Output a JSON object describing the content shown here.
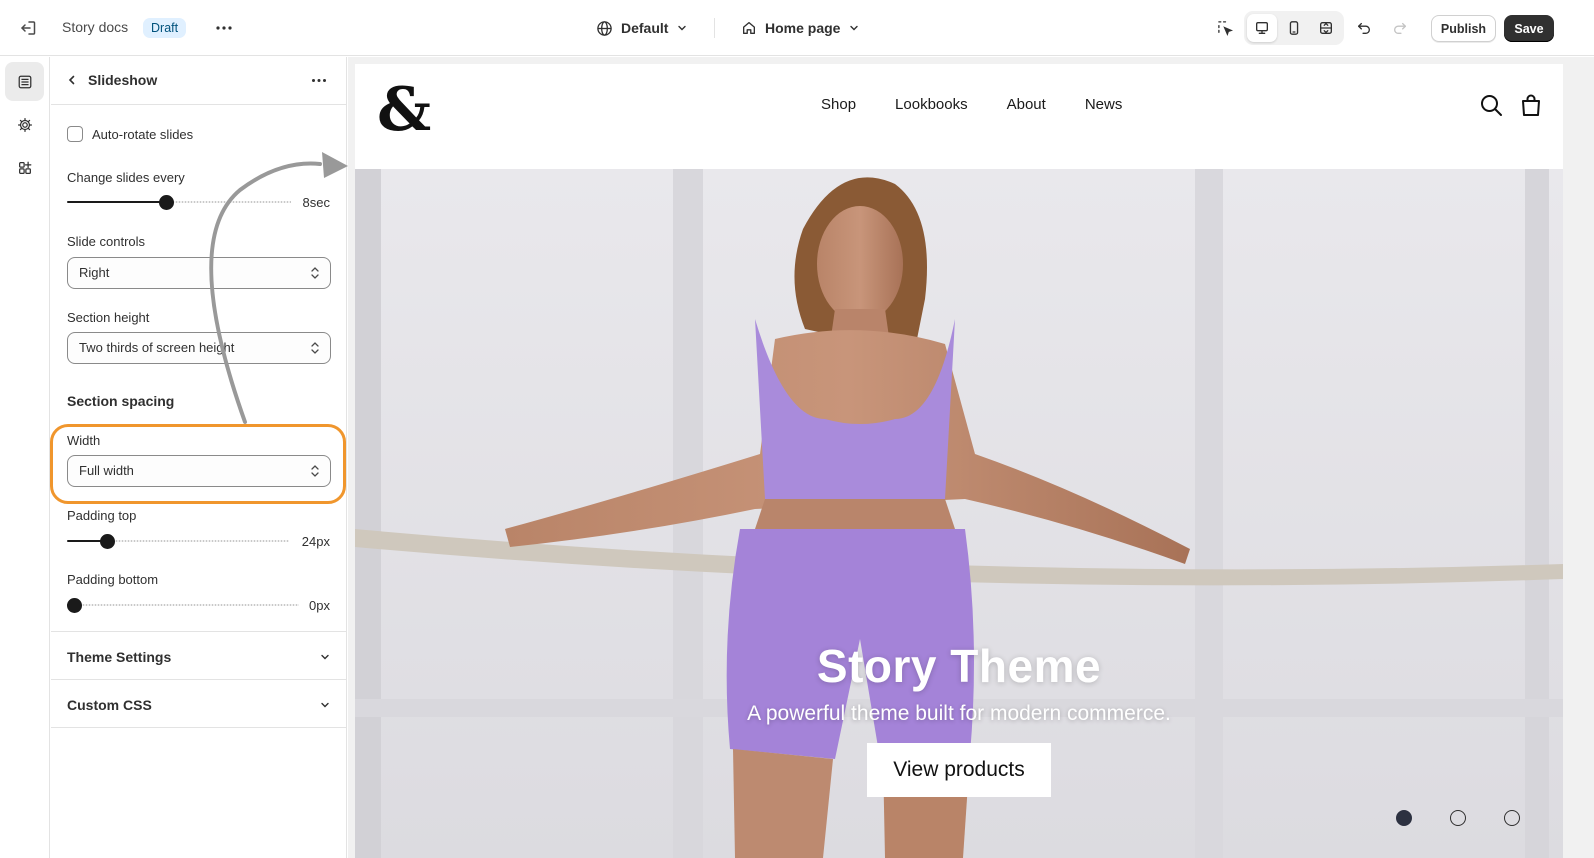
{
  "topbar": {
    "store_name": "Story docs",
    "status_badge": "Draft",
    "theme_name": "Default",
    "page_name": "Home page",
    "publish_label": "Publish",
    "save_label": "Save",
    "device_selected": "desktop"
  },
  "sidebar": {
    "items": [
      {
        "icon": "sections-icon",
        "active": true
      },
      {
        "icon": "gear-icon",
        "active": false
      },
      {
        "icon": "apps-icon",
        "active": false
      }
    ]
  },
  "panel": {
    "title": "Slideshow",
    "auto_rotate": {
      "label": "Auto-rotate slides",
      "checked": false
    },
    "change_slides": {
      "label": "Change slides every",
      "value": "8sec",
      "level": 0.44
    },
    "slide_controls": {
      "label": "Slide controls",
      "value": "Right"
    },
    "section_height": {
      "label": "Section height",
      "value": "Two thirds of screen height"
    },
    "section_spacing_heading": "Section spacing",
    "width": {
      "label": "Width",
      "value": "Full width"
    },
    "padding_top": {
      "label": "Padding top",
      "value": "24px",
      "level": 0.16
    },
    "padding_bottom": {
      "label": "Padding bottom",
      "value": "0px",
      "level": 0.0
    },
    "collapsibles": [
      "Theme Settings",
      "Custom CSS"
    ]
  },
  "preview": {
    "logo": "&",
    "nav": [
      "Shop",
      "Lookbooks",
      "About",
      "News"
    ],
    "hero_title": "Story Theme",
    "hero_subtitle": "A powerful theme built for modern commerce.",
    "hero_button": "View products",
    "slide_count": 3,
    "active_slide": 1
  },
  "colors": {
    "accent_highlight": "#f0962d",
    "draft_badge_bg": "#e0f0ff",
    "draft_badge_text": "#00527c",
    "save_button": "#303030"
  }
}
